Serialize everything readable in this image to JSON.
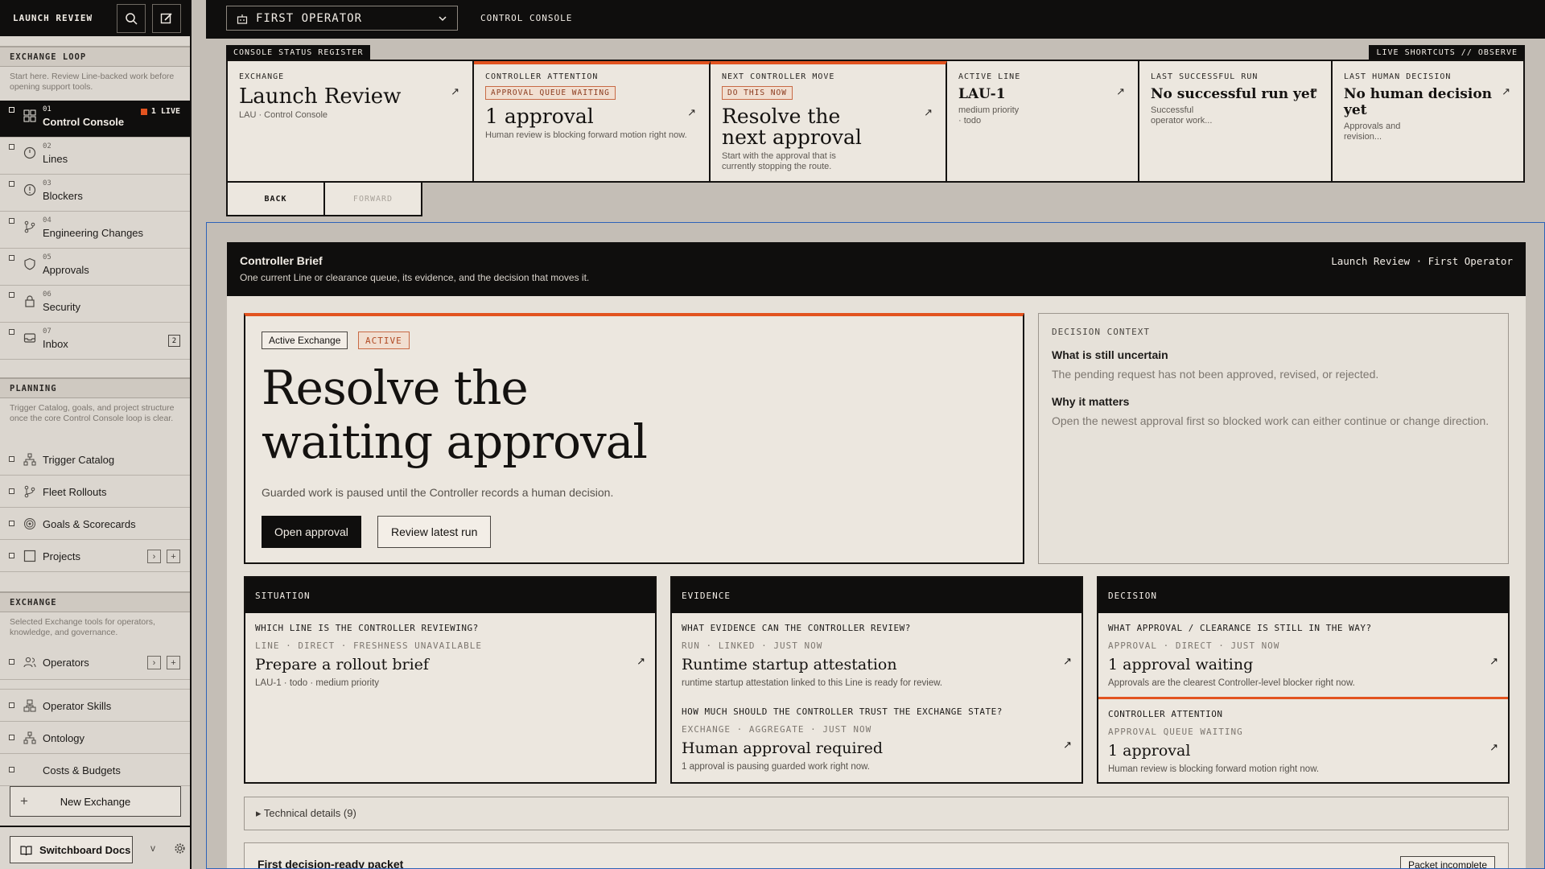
{
  "sidebar": {
    "title": "LAUNCH REVIEW",
    "sections": {
      "loop": {
        "heading": "EXCHANGE LOOP",
        "desc": "Start here. Review Line-backed work before opening support tools."
      },
      "planning": {
        "heading": "PLANNING",
        "desc": "Trigger Catalog, goals, and project structure once the core Control Console loop is clear."
      },
      "exchange": {
        "heading": "EXCHANGE",
        "desc": "Selected Exchange tools for operators, knowledge, and governance."
      }
    },
    "loop_items": [
      {
        "num": "01",
        "label": "Control Console",
        "badge": "1 LIVE"
      },
      {
        "num": "02",
        "label": "Lines"
      },
      {
        "num": "03",
        "label": "Blockers"
      },
      {
        "num": "04",
        "label": "Engineering Changes"
      },
      {
        "num": "05",
        "label": "Approvals"
      },
      {
        "num": "06",
        "label": "Security"
      },
      {
        "num": "07",
        "label": "Inbox",
        "count": "2"
      }
    ],
    "planning_items": [
      "Trigger Catalog",
      "Fleet Rollouts",
      "Goals & Scorecards",
      "Projects"
    ],
    "exchange_items": [
      "Operators",
      "Operator Skills",
      "Ontology",
      "Costs & Budgets"
    ],
    "new_exchange": "New Exchange",
    "docs": "Switchboard Docs",
    "version_toggle": "v"
  },
  "topbar": {
    "operator": "FIRST OPERATOR",
    "console": "CONTROL CONSOLE"
  },
  "register": {
    "tag": "CONSOLE STATUS REGISTER",
    "shortcuts": "LIVE SHORTCUTS // OBSERVE",
    "exchange": {
      "key": "EXCHANGE",
      "title": "Launch Review",
      "sub": "LAU · Control Console"
    },
    "attention": {
      "key": "CONTROLLER ATTENTION",
      "chip": "APPROVAL QUEUE WAITING",
      "title": "1 approval",
      "sub": "Human review is blocking forward motion right now."
    },
    "next_move": {
      "key": "NEXT CONTROLLER MOVE",
      "chip": "DO THIS NOW",
      "title": "Resolve the next approval",
      "sub": "Start with the approval that is currently stopping the route."
    },
    "active_line": {
      "key": "ACTIVE LINE",
      "title": "LAU-1",
      "sub1": "medium priority",
      "sub2": "· todo"
    },
    "last_run": {
      "key": "LAST SUCCESSFUL RUN",
      "title": "No successful run yet",
      "sub1": "Successful",
      "sub2": "operator work..."
    },
    "last_decision": {
      "key": "LAST HUMAN DECISION",
      "title": "No human decision yet",
      "sub1": "Approvals and",
      "sub2": "revision..."
    },
    "back": "BACK",
    "forward": "FORWARD"
  },
  "brief": {
    "title": "Controller Brief",
    "subtitle": "One current Line or clearance queue, its evidence, and the decision that moves it.",
    "crumb": "Launch Review · First Operator",
    "hero": {
      "pill": "Active Exchange",
      "status": "ACTIVE",
      "heading_line1": "Resolve the",
      "heading_line2": "waiting approval",
      "desc": "Guarded work is paused until the Controller records a human decision.",
      "primary": "Open approval",
      "secondary": "Review latest run"
    },
    "context": {
      "key": "DECISION CONTEXT",
      "q1": "What is still uncertain",
      "a1": "The pending request has not been approved, revised, or rejected.",
      "q2": "Why it matters",
      "a2": "Open the newest approval first so blocked work can either continue or change direction."
    },
    "situation": {
      "head": "SITUATION",
      "q": "WHICH LINE IS THE CONTROLLER REVIEWING?",
      "meta": "LINE · DIRECT · FRESHNESS UNAVAILABLE",
      "title": "Prepare a rollout brief",
      "desc": "LAU-1 · todo · medium priority"
    },
    "evidence": {
      "head": "EVIDENCE",
      "q1": "WHAT EVIDENCE CAN THE CONTROLLER REVIEW?",
      "meta1": "RUN · LINKED · JUST NOW",
      "title1": "Runtime startup attestation",
      "desc1": "runtime startup attestation linked to this Line is ready for review.",
      "q2": "HOW MUCH SHOULD THE CONTROLLER TRUST THE EXCHANGE STATE?",
      "meta2": "EXCHANGE · AGGREGATE · JUST NOW",
      "title2": "Human approval required",
      "desc2": "1 approval is pausing guarded work right now."
    },
    "decision": {
      "head": "DECISION",
      "q1": "WHAT APPROVAL / CLEARANCE IS STILL IN THE WAY?",
      "meta1": "APPROVAL · DIRECT · JUST NOW",
      "title1": "1 approval waiting",
      "desc1": "Approvals are the clearest Controller-level blocker right now.",
      "q2": "CONTROLLER ATTENTION",
      "meta2": "APPROVAL QUEUE WAITING",
      "title2": "1 approval",
      "desc2": "Human review is blocking forward motion right now."
    },
    "technical": "▸ Technical details (9)",
    "packet_title": "First decision-ready packet",
    "packet_badge": "Packet incomplete"
  },
  "colors": {
    "accent": "#e2531f",
    "ink": "#0f0e0d",
    "paper": "#ece7df",
    "focus": "#2e63b8"
  }
}
